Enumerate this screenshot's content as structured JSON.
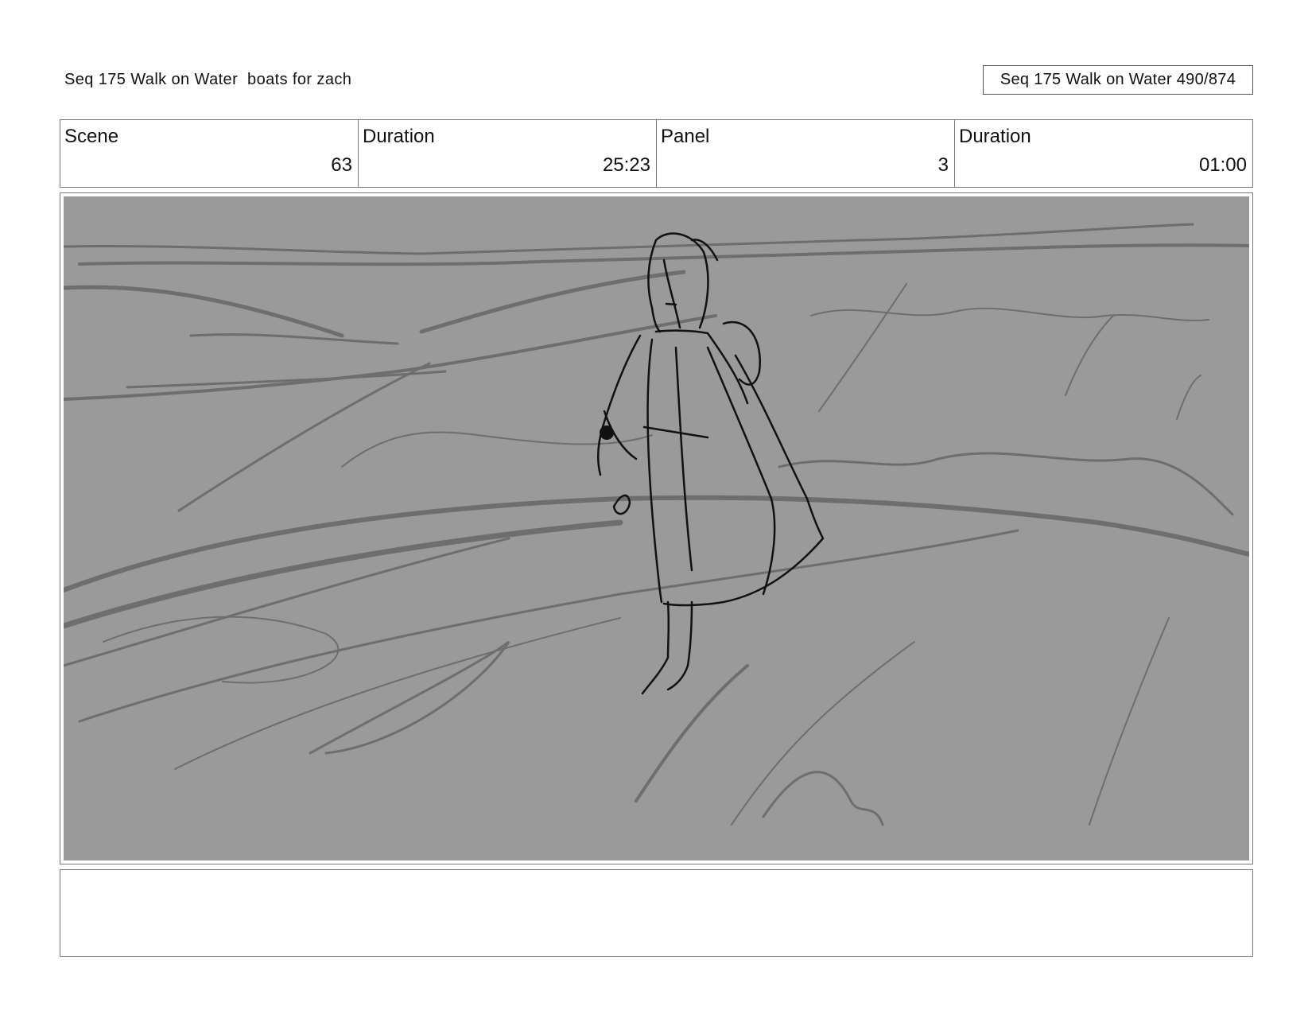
{
  "header": {
    "title": "Seq 175 Walk on Water  boats for zach",
    "page_counter": "Seq 175 Walk on Water 490/874"
  },
  "info": {
    "scene_label": "Scene",
    "scene_value": "63",
    "scene_duration_label": "Duration",
    "scene_duration_value": "25:23",
    "panel_label": "Panel",
    "panel_value": "3",
    "panel_duration_label": "Duration",
    "panel_duration_value": "01:00"
  },
  "panel": {
    "background_color": "#9a9a9a",
    "line_color": "#111111",
    "shading_color": "#6e6e6e"
  },
  "notes": {
    "text": ""
  }
}
